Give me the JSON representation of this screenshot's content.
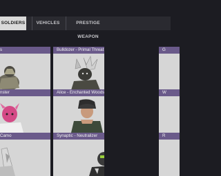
{
  "tabs": [
    {
      "label": "SOLDIERS",
      "active": true
    },
    {
      "label": "VEHICLES",
      "active": false
    },
    {
      "label": "PRESTIGE WEAPON",
      "active": false
    }
  ],
  "cards": [
    {
      "title": "s",
      "icon": "operator-armored-icon"
    },
    {
      "title": "Bulldozer - Primal Threat",
      "icon": "operator-horned-beast-icon"
    },
    {
      "title": "G",
      "icon": "operator-partial-icon"
    },
    {
      "title": "nster",
      "icon": "operator-pink-monster-icon"
    },
    {
      "title": "Alice - Enchanted Woods",
      "icon": "operator-alice-icon"
    },
    {
      "title": "W",
      "icon": "operator-partial-icon"
    },
    {
      "title": "Camo",
      "icon": "operator-camo-icon"
    },
    {
      "title": "Synaptic - Neutralizer",
      "icon": "operator-synaptic-icon"
    },
    {
      "title": "R",
      "icon": "operator-partial-icon"
    }
  ],
  "colors": {
    "header_purple": "#6a5a8a",
    "card_bg": "#d6d6d6",
    "active_tab": "#d9d9d9"
  }
}
